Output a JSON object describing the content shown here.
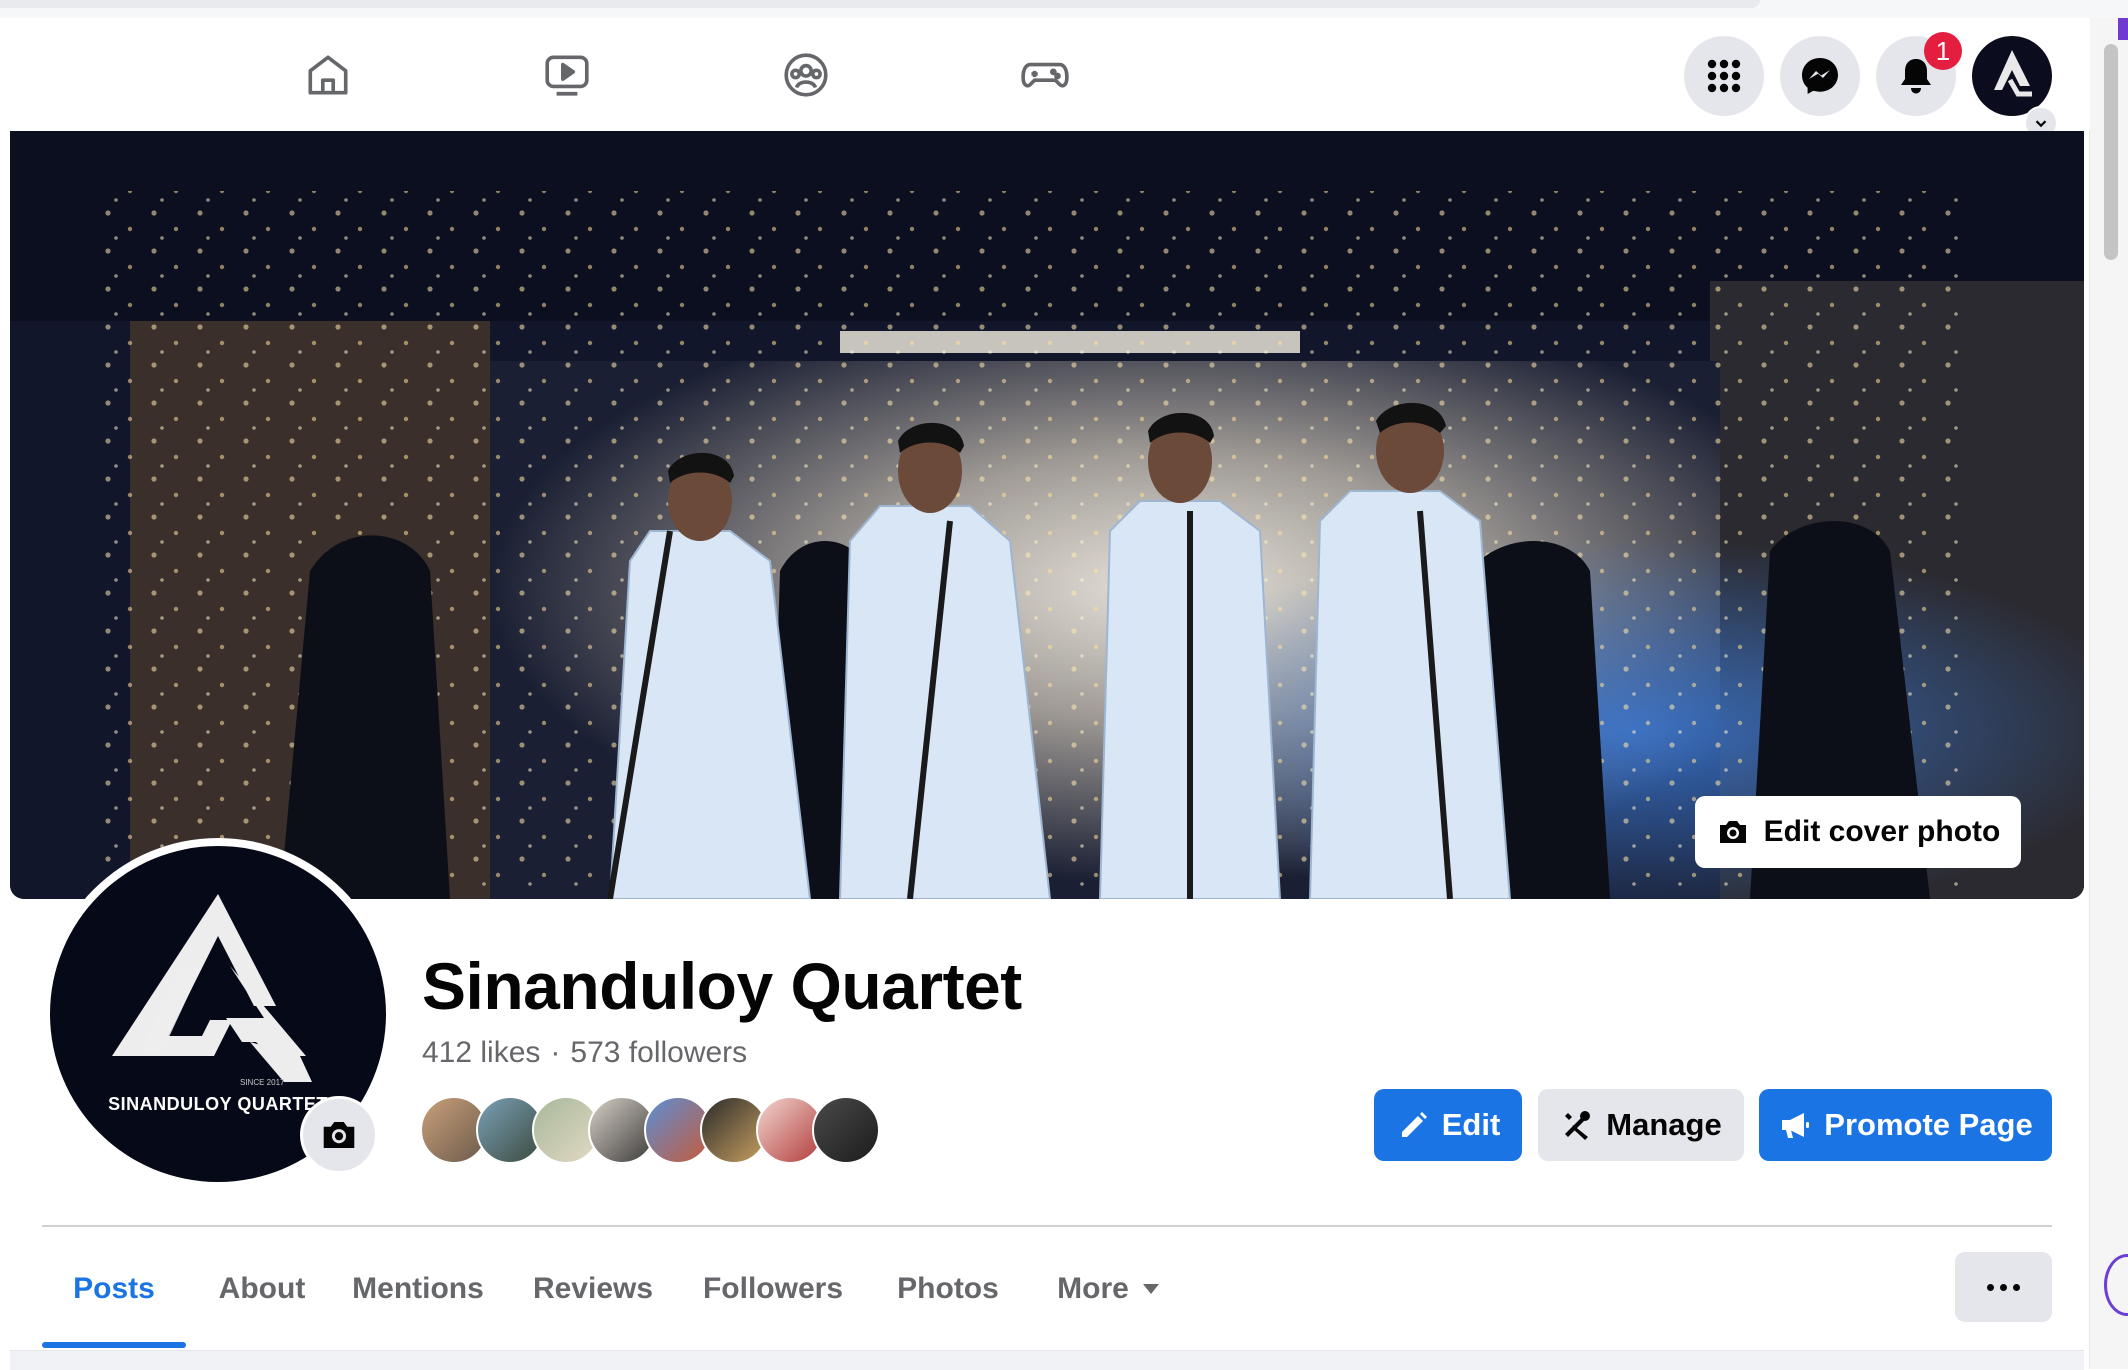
{
  "nav": {
    "tabs": [
      {
        "name": "home-icon"
      },
      {
        "name": "watch-icon"
      },
      {
        "name": "groups-icon"
      },
      {
        "name": "gaming-icon"
      }
    ],
    "right_buttons": [
      {
        "name": "menu-grid-icon"
      },
      {
        "name": "messenger-icon"
      },
      {
        "name": "bell-icon"
      }
    ],
    "notification_count": "1"
  },
  "cover": {
    "edit_cover_label": "Edit cover photo"
  },
  "profile": {
    "logo_text": "SINANDULOY QUARTET",
    "logo_since": "SINCE 2017"
  },
  "page": {
    "name": "Sinanduloy Quartet",
    "likes": "412 likes",
    "separator": "·",
    "followers": "573 followers"
  },
  "actions": {
    "edit_label": "Edit",
    "manage_label": "Manage",
    "promote_label": "Promote Page"
  },
  "tabs": [
    {
      "label": "Posts",
      "active": true
    },
    {
      "label": "About"
    },
    {
      "label": "Mentions"
    },
    {
      "label": "Reviews"
    },
    {
      "label": "Followers"
    },
    {
      "label": "Photos"
    },
    {
      "label": "More"
    }
  ],
  "colors": {
    "accent": "#1b74e4",
    "badge": "#e41e3f",
    "button_gray": "#e4e6eb"
  }
}
